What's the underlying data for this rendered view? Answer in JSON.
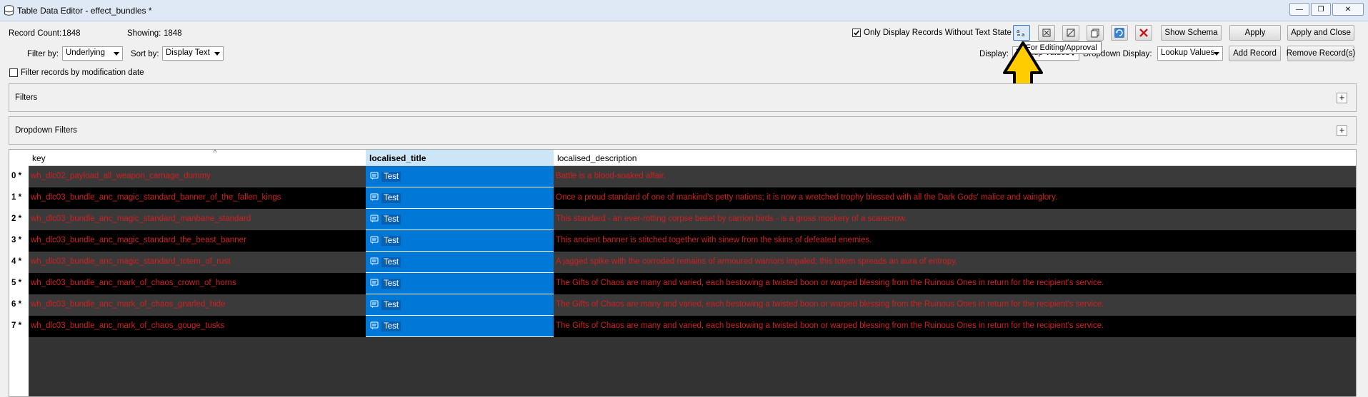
{
  "window": {
    "title": "Table Data Editor - effect_bundles *",
    "controls": [
      "minimize-icon",
      "restore-icon",
      "close-icon"
    ]
  },
  "stats": {
    "record_count_label": "Record Count:",
    "record_count": "1848",
    "showing_label": "Showing:",
    "showing": "1848"
  },
  "filters_row": {
    "filter_by_label": "Filter by:",
    "filter_by_value": "Underlying",
    "sort_by_label": "Sort by:",
    "sort_by_value": "Display Text",
    "modification_filter_label": "Filter records by modification date"
  },
  "top_right": {
    "only_display_label": "Only Display Records Without Text State",
    "show_schema": "Show Schema",
    "apply": "Apply",
    "apply_close": "Apply and Close",
    "display_label": "Display:",
    "display_value": "Lookup Values",
    "dropdown_display_label": "Dropdown Display:",
    "dropdown_display_value": "Lookup Values",
    "add_record": "Add Record",
    "remove_records": "Remove Record(s)",
    "tooltip": "For Editing/Approval"
  },
  "panels": {
    "filters": "Filters",
    "dropdown_filters": "Dropdown Filters"
  },
  "table": {
    "columns": [
      "key",
      "localised_title",
      "localised_description"
    ],
    "rows": [
      {
        "num": "0 *",
        "key": "wh_dlc02_payload_all_weapon_carnage_dummy",
        "title": "Test",
        "desc": "Battle is a blood-soaked affair."
      },
      {
        "num": "1 *",
        "key": "wh_dlc03_bundle_anc_magic_standard_banner_of_the_fallen_kings",
        "title": "Test",
        "desc": "Once a proud standard of one of mankind's petty nations; it is now a wretched trophy blessed with all the Dark Gods' malice and vainglory."
      },
      {
        "num": "2 *",
        "key": "wh_dlc03_bundle_anc_magic_standard_manbane_standard",
        "title": "Test",
        "desc": "This standard - an ever-rotting corpse beset by carrion birds - is a gross mockery of a scarecrow."
      },
      {
        "num": "3 *",
        "key": "wh_dlc03_bundle_anc_magic_standard_the_beast_banner",
        "title": "Test",
        "desc": "This ancient banner is stitched together with sinew from the skins of defeated enemies."
      },
      {
        "num": "4 *",
        "key": "wh_dlc03_bundle_anc_magic_standard_totem_of_rust",
        "title": "Test",
        "desc": "A jagged spike with the corroded remains of armoured warriors impaled; this totem spreads an aura of entropy."
      },
      {
        "num": "5 *",
        "key": "wh_dlc03_bundle_anc_mark_of_chaos_crown_of_horns",
        "title": "Test",
        "desc": "The Gifts of Chaos are many and varied, each bestowing a twisted boon or warped blessing from the Ruinous Ones in return for the recipient's service."
      },
      {
        "num": "6 *",
        "key": "wh_dlc03_bundle_anc_mark_of_chaos_gnarled_hide",
        "title": "Test",
        "desc": "The Gifts of Chaos are many and varied, each bestowing a twisted boon or warped blessing from the Ruinous Ones in return for the recipient's service."
      },
      {
        "num": "7 *",
        "key": "wh_dlc03_bundle_anc_mark_of_chaos_gouge_tusks",
        "title": "Test",
        "desc": "The Gifts of Chaos are many and varied, each bestowing a twisted boon or warped blessing from the Ruinous Ones in return for the recipient's service."
      }
    ]
  },
  "colors": {
    "row_dark": "#000000",
    "row_grey": "#3a3a3a",
    "text_red": "#d02020",
    "selection_blue": "#0078d7",
    "annotation_arrow": "#ffcc00"
  }
}
